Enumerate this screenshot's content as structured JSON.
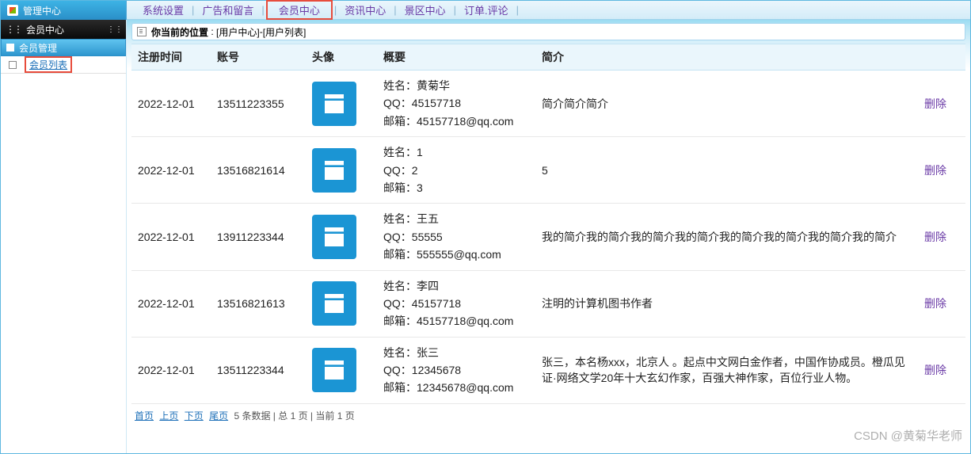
{
  "topbar": {
    "title": "管理中心",
    "nav": [
      "系统设置",
      "广告和留言",
      "会员中心",
      "资讯中心",
      "景区中心",
      "订单.评论"
    ],
    "highlight_index": 2
  },
  "sidebar": {
    "title": "会员中心",
    "group": "会员管理",
    "leaf": "会员列表"
  },
  "breadcrumb": {
    "label": "你当前的位置",
    "path1": "[用户中心]",
    "path2": "[用户列表]"
  },
  "table": {
    "headers": [
      "注册时间",
      "账号",
      "头像",
      "概要",
      "简介",
      ""
    ],
    "summary_labels": {
      "name": "姓名",
      "qq": "QQ",
      "email": "邮箱"
    },
    "delete_label": "删除",
    "rows": [
      {
        "time": "2022-12-01",
        "account": "13511223355",
        "name": "黄菊华",
        "qq": "45157718",
        "email": "45157718@qq.com",
        "intro": "简介简介简介"
      },
      {
        "time": "2022-12-01",
        "account": "13516821614",
        "name": "1",
        "qq": "2",
        "email": "3",
        "intro": "5"
      },
      {
        "time": "2022-12-01",
        "account": "13911223344",
        "name": "王五",
        "qq": "55555",
        "email": "555555@qq.com",
        "intro": "我的简介我的简介我的简介我的简介我的简介我的简介我的简介我的简介"
      },
      {
        "time": "2022-12-01",
        "account": "13516821613",
        "name": "李四",
        "qq": "45157718",
        "email": "45157718@qq.com",
        "intro": "注明的计算机图书作者"
      },
      {
        "time": "2022-12-01",
        "account": "13511223344",
        "name": "张三",
        "qq": "12345678",
        "email": "12345678@qq.com",
        "intro": "张三，本名杨xxx，北京人 。起点中文网白金作者，中国作协成员。橙瓜见证·网络文学20年十大玄幻作家，百强大神作家，百位行业人物。"
      }
    ]
  },
  "pager": {
    "first": "首页",
    "prev": "上页",
    "next": "下页",
    "last": "尾页",
    "info": "5 条数据 | 总 1 页 | 当前 1 页"
  },
  "watermark": "CSDN @黄菊华老师"
}
